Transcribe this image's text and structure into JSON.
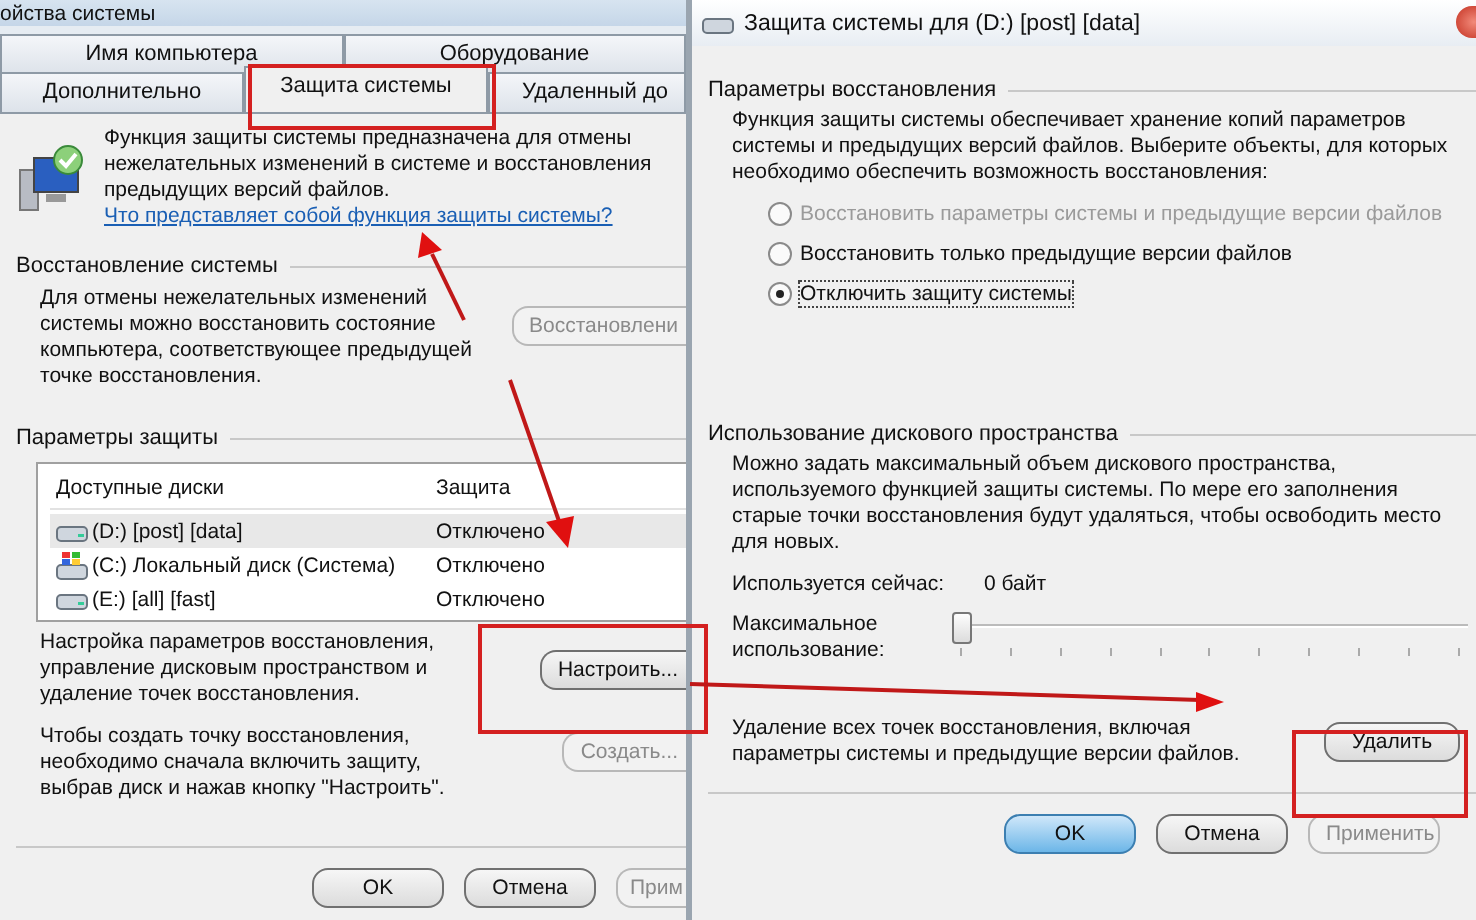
{
  "left_window": {
    "title": "ойства системы",
    "tab_rows": [
      {
        "tabs": [
          {
            "label": "Имя компьютера",
            "selected": false
          },
          {
            "label": "Оборудование",
            "selected": false
          }
        ]
      },
      {
        "tabs": [
          {
            "label": "Дополнительно",
            "selected": false
          },
          {
            "label": "Защита системы",
            "selected": true
          },
          {
            "label": "Удаленный до",
            "selected": false
          }
        ]
      }
    ],
    "intro": {
      "text": "Функция защиты системы предназначена для отмены нежелательных изменений в системе и восстановления предыдущих версий файлов.",
      "link": "Что представляет собой функция защиты системы?"
    },
    "restore": {
      "heading": "Восстановление системы",
      "text": "Для отмены нежелательных изменений системы можно восстановить состояние компьютера, соответствующее предыдущей точке восстановления.",
      "button": {
        "label": "Восстановлени",
        "disabled": true
      }
    },
    "protection": {
      "heading": "Параметры защиты",
      "columns": [
        "Доступные диски",
        "Защита"
      ],
      "rows": [
        {
          "kind": "drive",
          "name": "(D:) [post] [data]",
          "status": "Отключено",
          "selected": true
        },
        {
          "kind": "system",
          "name": "(C:) Локальный диск (Система)",
          "status": "Отключено",
          "selected": false
        },
        {
          "kind": "drive",
          "name": "(E:) [all] [fast]",
          "status": "Отключено",
          "selected": false
        }
      ]
    },
    "configure": {
      "text": "Настройка параметров восстановления, управление дисковым пространством и удаление точек восстановления.",
      "button": {
        "label": "Настроить...",
        "disabled": false
      }
    },
    "create": {
      "text": "Чтобы создать точку восстановления, необходимо сначала включить защиту, выбрав диск и нажав кнопку \"Настроить\".",
      "button": {
        "label": "Создать...",
        "disabled": true
      }
    },
    "buttons": [
      {
        "label": "OK",
        "disabled": false
      },
      {
        "label": "Отмена",
        "disabled": false
      },
      {
        "label": "Прим",
        "disabled": true
      }
    ]
  },
  "right_window": {
    "title": "Защита системы для (D:) [post] [data]",
    "restore_settings": {
      "heading": "Параметры восстановления",
      "text": "Функция защиты системы обеспечивает хранение копий параметров системы и предыдущих версий файлов. Выберите объекты, для которых необходимо обеспечить возможность восстановления:",
      "options": [
        {
          "label": "Восстановить параметры системы и предыдущие версии файлов",
          "selected": false,
          "disabled": true
        },
        {
          "label": "Восстановить только предыдущие версии файлов",
          "selected": false,
          "disabled": false
        },
        {
          "label": "Отключить защиту системы",
          "selected": true,
          "disabled": false
        }
      ]
    },
    "disk_usage": {
      "heading": "Использование дискового пространства",
      "text": "Можно задать максимальный объем дискового пространства, используемого функцией защиты системы. По мере его заполнения старые точки восстановления будут удаляться, чтобы освободить место для новых.",
      "current_label": "Используется сейчас:",
      "current_value": "0 байт",
      "max_label": "Максимальное использование:",
      "level": 0
    },
    "delete": {
      "text": "Удаление всех точек восстановления, включая параметры системы и предыдущие версии файлов.",
      "button": "Удалить"
    },
    "buttons": [
      {
        "label": "OK",
        "default": true,
        "disabled": false
      },
      {
        "label": "Отмена",
        "default": false,
        "disabled": false
      },
      {
        "label": "Применить",
        "default": false,
        "disabled": true
      }
    ]
  }
}
